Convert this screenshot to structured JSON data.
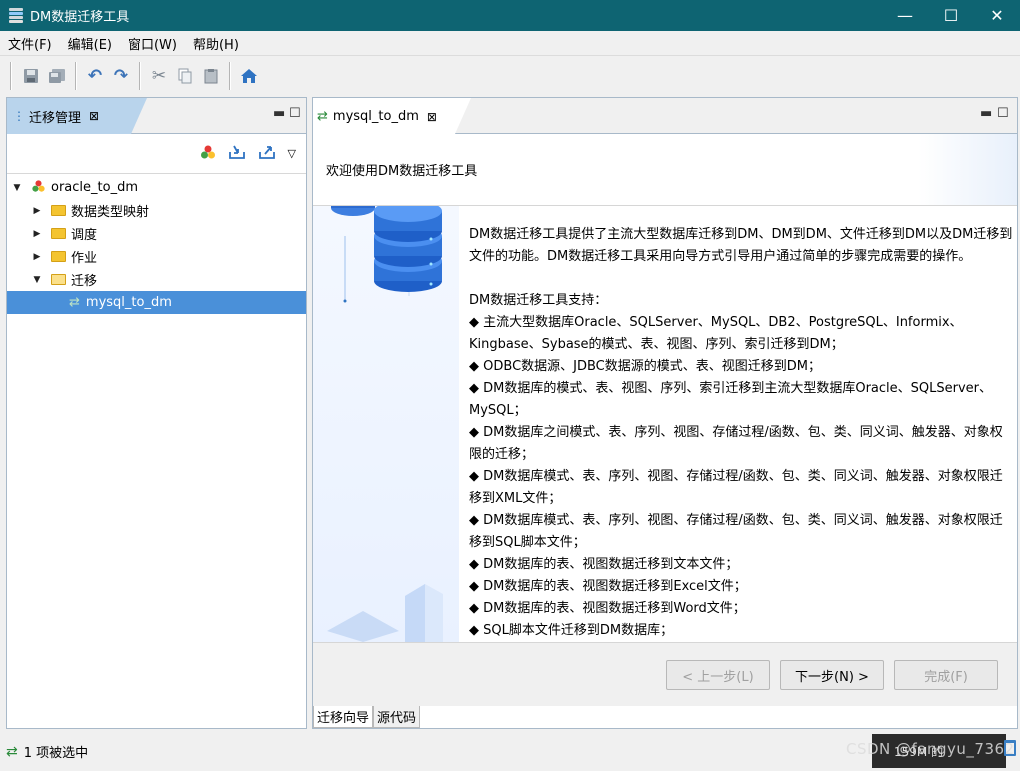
{
  "window": {
    "title": "DM数据迁移工具",
    "controls": {
      "minimize": "—",
      "maximize": "☐",
      "close": "✕"
    }
  },
  "menubar": {
    "items": [
      {
        "label": "文件(F)"
      },
      {
        "label": "编辑(E)"
      },
      {
        "label": "窗口(W)"
      },
      {
        "label": "帮助(H)"
      }
    ]
  },
  "toolbar": {
    "icons": [
      "save-icon",
      "save-all-icon",
      "undo-icon",
      "redo-icon",
      "cut-icon",
      "copy-icon",
      "paste-icon",
      "home-icon"
    ]
  },
  "left_panel": {
    "tab_label": "迁移管理",
    "tree": {
      "root": "oracle_to_dm",
      "children": [
        {
          "label": "数据类型映射"
        },
        {
          "label": "调度"
        },
        {
          "label": "作业"
        },
        {
          "label": "迁移"
        }
      ],
      "leaf": "mysql_to_dm"
    }
  },
  "editor": {
    "tab_label": "mysql_to_dm",
    "welcome": "欢迎使用DM数据迁移工具",
    "intro": "DM数据迁移工具提供了主流大型数据库迁移到DM、DM到DM、文件迁移到DM以及DM迁移到文件的功能。DM数据迁移工具采用向导方式引导用户通过简单的步骤完成需要的操作。",
    "support_heading": "DM数据迁移工具支持：",
    "support_items": [
      "◆  主流大型数据库Oracle、SQLServer、MySQL、DB2、PostgreSQL、Informix、Kingbase、Sybase的模式、表、视图、序列、索引迁移到DM；",
      "◆ ODBC数据源、JDBC数据源的模式、表、视图迁移到DM；",
      "◆ DM数据库的模式、表、视图、序列、索引迁移到主流大型数据库Oracle、SQLServer、MySQL；",
      "◆ DM数据库之间模式、表、序列、视图、存储过程/函数、包、类、同义词、触发器、对象权限的迁移；",
      "◆ DM数据库模式、表、序列、视图、存储过程/函数、包、类、同义词、触发器、对象权限迁移到XML文件；",
      "◆ DM数据库模式、表、序列、视图、存储过程/函数、包、类、同义词、触发器、对象权限迁移到SQL脚本文件；",
      "◆ DM数据库的表、视图数据迁移到文本文件；",
      "◆ DM数据库的表、视图数据迁移到Excel文件；",
      "◆ DM数据库的表、视图数据迁移到Word文件；",
      "◆ SQL脚本文件迁移到DM数据库；"
    ],
    "buttons": {
      "prev": "< 上一步(L)",
      "next": "下一步(N) >",
      "finish": "完成(F)"
    },
    "bottom_tabs": [
      "迁移向导",
      "源代码"
    ]
  },
  "status": {
    "text": "1 项被选中",
    "memory": "159M 的",
    "watermark": "CSDN @fangyu_7362"
  },
  "colors": {
    "titlebar": "#0e6472",
    "selection": "#4a90d9",
    "tab_active": "#b9d4ec"
  }
}
